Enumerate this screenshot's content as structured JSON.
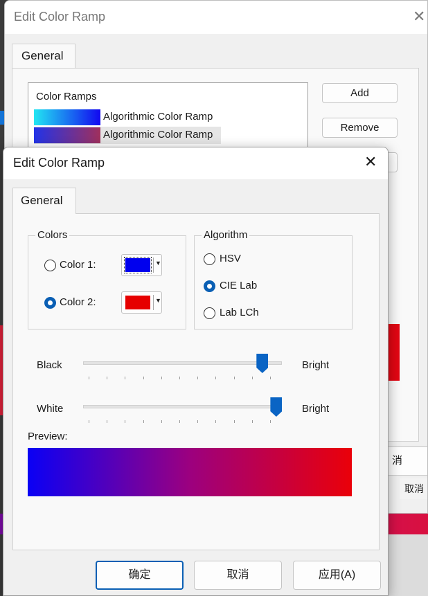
{
  "background_dialog": {
    "title": "Edit Color Ramp",
    "close_glyph": "✕",
    "tab_label": "General",
    "list_header": "Color Ramps",
    "ramps": [
      {
        "label": "Algorithmic Color Ramp",
        "from": "#22e6f2",
        "to": "#1208f0",
        "selected": false
      },
      {
        "label": "Algorithmic Color Ramp",
        "from": "#2233e8",
        "to": "#a0305c",
        "selected": true
      }
    ],
    "add_label": "Add",
    "remove_label": "Remove",
    "cancel_label_1": "消",
    "cancel_label_2": "取消"
  },
  "dialog": {
    "title": "Edit Color Ramp",
    "close_glyph": "✕",
    "tab_label": "General",
    "colors_group": {
      "legend": "Colors",
      "color1_label": "Color 1:",
      "color2_label": "Color 2:",
      "color1_value": "#0000ee",
      "color2_value": "#e60000",
      "selected": "color2"
    },
    "algorithm_group": {
      "legend": "Algorithm",
      "options": [
        "HSV",
        "CIE Lab",
        "Lab LCh"
      ],
      "selected": "CIE Lab"
    },
    "black_slider": {
      "left_label": "Black",
      "right_label": "Bright",
      "value_fraction": 0.9
    },
    "white_slider": {
      "left_label": "White",
      "right_label": "Bright",
      "value_fraction": 0.97
    },
    "preview_label": "Preview:",
    "preview_from": "#0a00f5",
    "preview_mid": "#9c007f",
    "preview_to": "#ea0009",
    "ok_label": "确定",
    "cancel_label": "取消",
    "apply_label": "应用(A)"
  },
  "accent_color": "#0a5fb4"
}
